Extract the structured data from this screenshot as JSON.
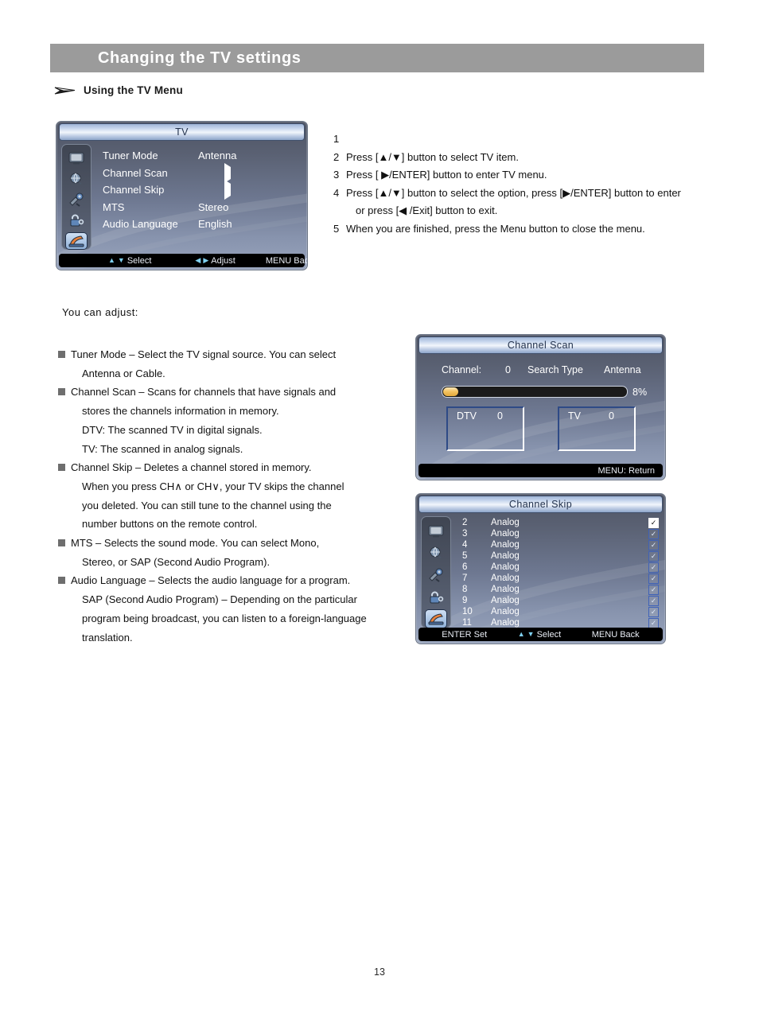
{
  "header": {
    "title": "Changing the TV settings"
  },
  "section": {
    "icon": "dart-arrow-icon",
    "label": "Using the TV Menu"
  },
  "tv_menu": {
    "title": "TV",
    "rail_icons": [
      "picture-icon",
      "globe-audio-icon",
      "tools-setup-icon",
      "lock-icon",
      "antenna-tv-icon"
    ],
    "rows": [
      {
        "label": "Tuner Mode",
        "value": "Antenna",
        "type": "value"
      },
      {
        "label": "Channel  Scan",
        "value": "",
        "type": "arrow"
      },
      {
        "label": "Channel  Skip",
        "value": "",
        "type": "arrow"
      },
      {
        "label": "MTS",
        "value": "Stereo",
        "type": "value"
      },
      {
        "label": "Audio  Language",
        "value": "English",
        "type": "value"
      }
    ],
    "footer": {
      "select": "Select",
      "adjust": "Adjust",
      "back": "MENU Back"
    }
  },
  "steps": [
    {
      "num": "1",
      "line1": "",
      "line2": ""
    },
    {
      "num": "2",
      "line1": "Press [▲/▼] button to select TV item.",
      "line2": ""
    },
    {
      "num": "3",
      "line1": "Press [ ▶/ENTER] button to enter TV menu.",
      "line2": ""
    },
    {
      "num": "4",
      "line1": "Press [▲/▼] button to select the option, press [▶/ENTER] button to enter",
      "line2": "or press [◀ /Exit] button to exit."
    },
    {
      "num": "5",
      "line1": "When you are finished, press the Menu button to close the menu.",
      "line2": ""
    }
  ],
  "body": {
    "intro": "You  can  adjust:",
    "bullets": [
      {
        "lines": [
          "Tuner Mode – Select the TV signal source.  You can select",
          "Antenna or Cable."
        ]
      },
      {
        "lines": [
          "Channel Scan – Scans for channels that have signals and",
          "stores the channels information in memory.",
          "DTV: The scanned TV                     in digital signals.",
          "TV: The scanned                in analog signals."
        ]
      },
      {
        "lines": [
          "Channel Skip – Deletes a channel stored in memory.",
          "When you press CH∧ or CH∨,  your TV skips the  channel",
          "you deleted.  You can still tune to the channel using the",
          "number buttons on the remote control."
        ]
      },
      {
        "lines": [
          "MTS – Selects the sound mode.  You can select Mono,",
          "Stereo,  or SAP (Second Audio Program)."
        ]
      },
      {
        "lines": [
          "Audio Language – Selects the audio language for a program.",
          "SAP (Second Audio Program) – Depending on the particular",
          "program being broadcast, you can listen to a foreign-language",
          "translation."
        ]
      }
    ]
  },
  "channel_scan": {
    "title": "Channel Scan",
    "channel_label": "Channel:",
    "channel_value": "0",
    "search_type_label": "Search Type",
    "search_type_value": "Antenna",
    "progress_percent": "8%",
    "progress_value": 8,
    "boxes": [
      {
        "label": "DTV",
        "value": "0"
      },
      {
        "label": "TV",
        "value": "0"
      }
    ],
    "footer": {
      "return": "MENU:  Return"
    }
  },
  "channel_skip": {
    "title": "Channel Skip",
    "rail_icons": [
      "picture-icon",
      "globe-audio-icon",
      "tools-setup-icon",
      "lock-icon",
      "antenna-tv-icon"
    ],
    "rows": [
      {
        "channel": "2",
        "type": "Analog",
        "checked": true,
        "highlighted": true
      },
      {
        "channel": "3",
        "type": "Analog",
        "checked": true,
        "highlighted": false
      },
      {
        "channel": "4",
        "type": "Analog",
        "checked": true,
        "highlighted": false
      },
      {
        "channel": "5",
        "type": "Analog",
        "checked": true,
        "highlighted": false
      },
      {
        "channel": "6",
        "type": "Analog",
        "checked": true,
        "highlighted": false
      },
      {
        "channel": "7",
        "type": "Analog",
        "checked": true,
        "highlighted": false
      },
      {
        "channel": "8",
        "type": "Analog",
        "checked": true,
        "highlighted": false
      },
      {
        "channel": "9",
        "type": "Analog",
        "checked": true,
        "highlighted": false
      },
      {
        "channel": "10",
        "type": "Analog",
        "checked": true,
        "highlighted": false
      },
      {
        "channel": "11",
        "type": "Analog",
        "checked": true,
        "highlighted": false
      }
    ],
    "footer": {
      "enter": "ENTER  Set",
      "select": "Select",
      "back": "MENU  Back"
    }
  },
  "page_number": "13",
  "colors": {
    "header_band": "#9b9b9b",
    "osd_title_text": "#23324d",
    "progress_fill": "#f3c463",
    "bullet_square": "#6e6e6e"
  }
}
